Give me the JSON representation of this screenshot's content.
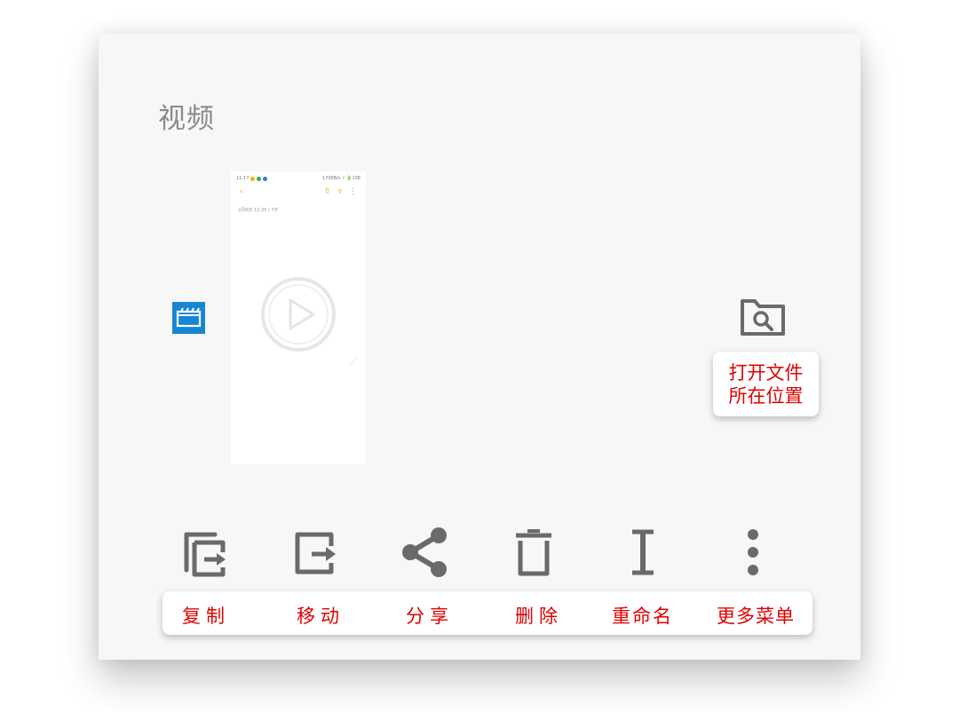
{
  "header": {
    "title": "视频"
  },
  "thumbnail": {
    "status_time": "11:17",
    "status_right": "170KB/s ⚡ 🔋108",
    "doc_line": "2月8日 12:35 | 7字"
  },
  "open_location": {
    "line1": "打开文件",
    "line2": "所在位置"
  },
  "actions": [
    {
      "icon": "copy-icon",
      "label": "复制"
    },
    {
      "icon": "move-icon",
      "label": "移动"
    },
    {
      "icon": "share-icon",
      "label": "分享"
    },
    {
      "icon": "delete-icon",
      "label": "删除"
    },
    {
      "icon": "rename-icon",
      "label": "重命名"
    },
    {
      "icon": "more-menu-icon",
      "label": "更多菜单"
    }
  ],
  "colors": {
    "icon_gray": "#6a6a6a",
    "label_red": "#e00000",
    "video_blue": "#1787d4"
  }
}
